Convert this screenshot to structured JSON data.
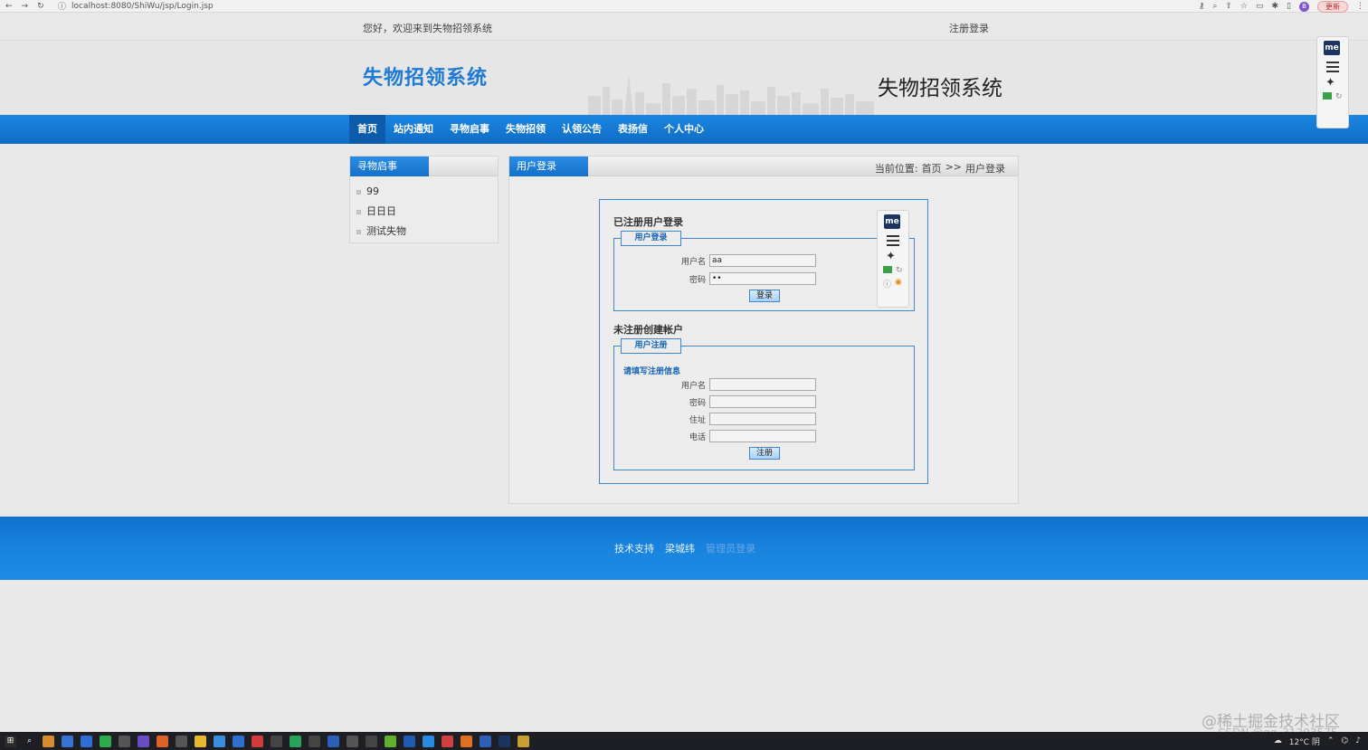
{
  "browser": {
    "url": "localhost:8080/ShiWu/jsp/Login.jsp",
    "avatar_letter": "B",
    "update_label": "更新"
  },
  "topbar": {
    "welcome": "您好，欢迎来到失物招领系统",
    "register_login": "注册登录"
  },
  "header": {
    "title": "失物招领系统",
    "title_right": "失物招领系统"
  },
  "nav": {
    "items": [
      "首页",
      "站内通知",
      "寻物启事",
      "失物招领",
      "认领公告",
      "表扬信",
      "个人中心"
    ]
  },
  "sidebar": {
    "title": "寻物启事",
    "items": [
      "99",
      "日日日",
      "测试失物"
    ]
  },
  "main": {
    "tab": "用户登录",
    "breadcrumb_label": "当前位置:",
    "breadcrumb_home": "首页",
    "breadcrumb_sep": ">>",
    "breadcrumb_current": "用户登录"
  },
  "login": {
    "section_title": "已注册用户登录",
    "legend": "用户登录",
    "username_label": "用户名",
    "username_value": "aa",
    "password_label": "密码",
    "password_value": "••",
    "submit": "登录"
  },
  "register": {
    "section_title": "未注册创建帐户",
    "legend": "用户注册",
    "hint": "请填写注册信息",
    "username_label": "用户名",
    "password_label": "密码",
    "address_label": "住址",
    "phone_label": "电话",
    "submit": "注册"
  },
  "extension": {
    "logo": "me"
  },
  "footer": {
    "support": "技术支持",
    "author": "梁城纬",
    "admin": "管理员登录"
  },
  "watermark": {
    "line1": "@稀土掘金技术社区",
    "line2": "CSDN @qq_31293575"
  },
  "taskbar": {
    "weather": "12°C 阴"
  },
  "colors": {
    "brand_blue": "#1a86e0",
    "title_blue": "#1f7ad4",
    "border_blue": "#3f86cf"
  }
}
